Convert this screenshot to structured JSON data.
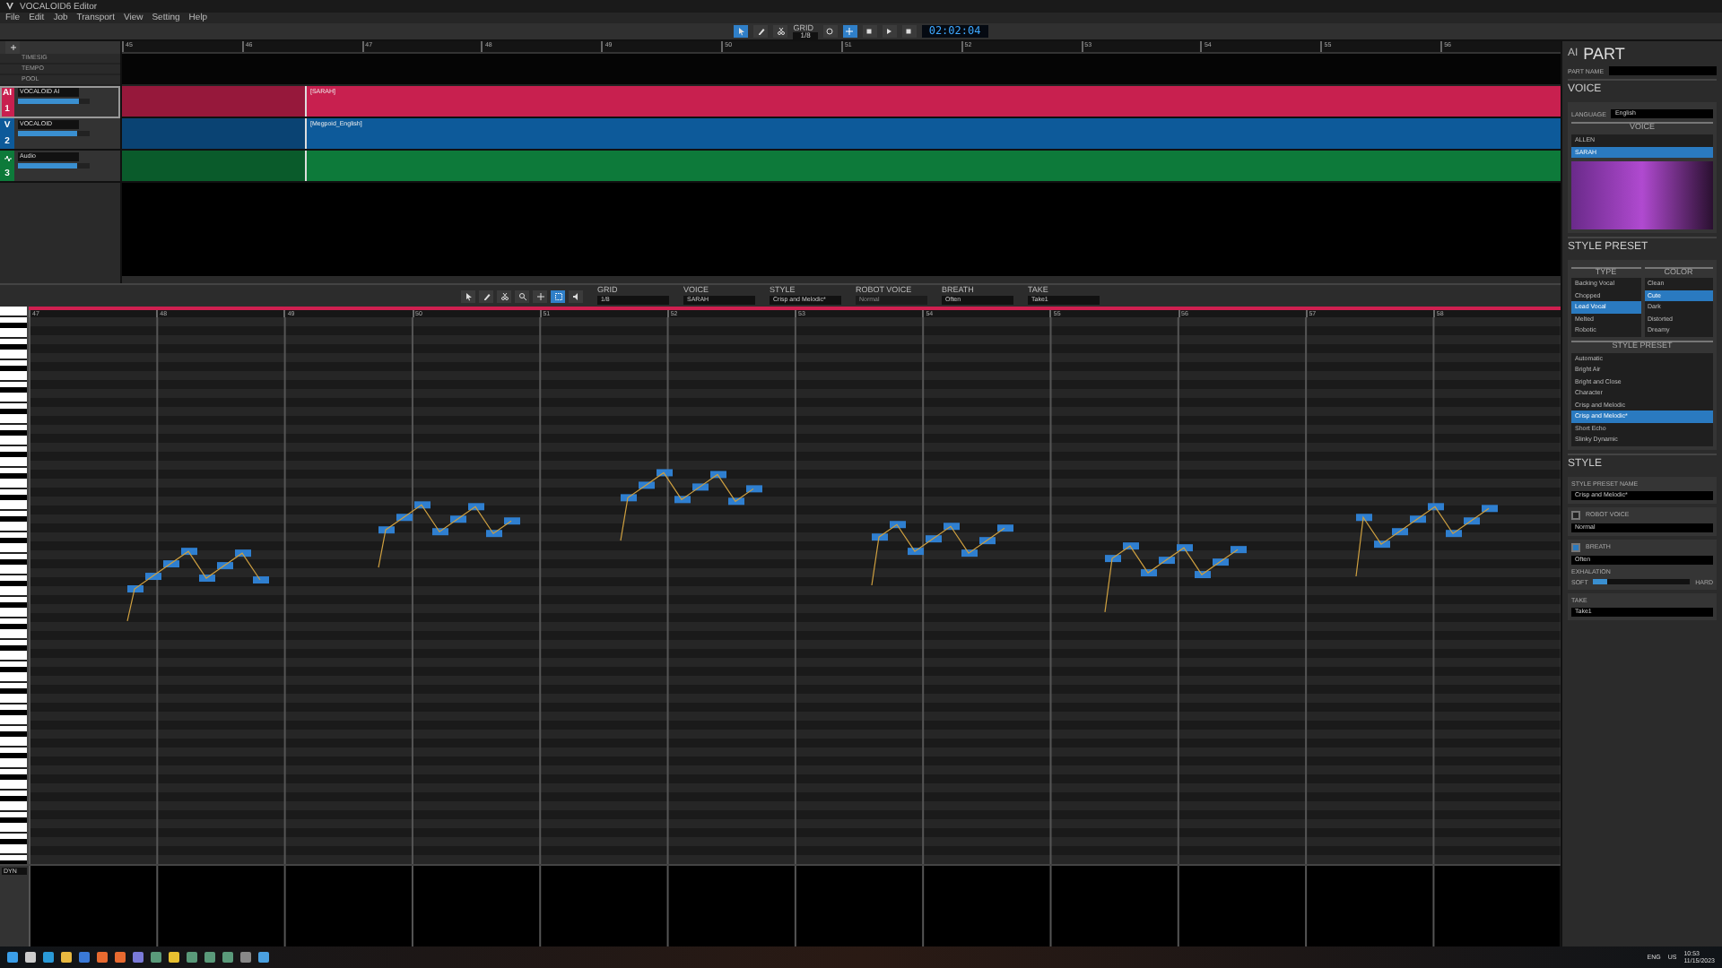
{
  "window": {
    "title": "VOCALOID6 Editor"
  },
  "menu": [
    "File",
    "Edit",
    "Job",
    "Transport",
    "View",
    "Setting",
    "Help"
  ],
  "toolbar": {
    "tools": [
      {
        "kind": "pointer",
        "selected": true
      },
      {
        "kind": "pencil",
        "selected": false
      },
      {
        "kind": "knife",
        "selected": false
      }
    ],
    "grid_label": "GRID",
    "grid_value": "1/8",
    "loop": false,
    "follow": true,
    "time": "02:02:04"
  },
  "global_tracks": [
    "TIMESIG",
    "TEMPO",
    "POOL"
  ],
  "tracks": [
    {
      "kind": "ai",
      "badge": "AI",
      "number": "1",
      "name": "VOCALOID AI",
      "color": "#c8204f",
      "part": "[SARAH]",
      "selected": true,
      "level": 0.85
    },
    {
      "kind": "vocaloid",
      "badge": "V",
      "number": "2",
      "name": "VOCALOID",
      "color": "#0d5a9a",
      "part": "[Megpoid_English]",
      "selected": false,
      "level": 0.82
    },
    {
      "kind": "audio",
      "number": "3",
      "name": "Audio",
      "color": "#0d7a3a",
      "selected": false,
      "level": 0.82
    }
  ],
  "ruler": [
    "45",
    "46",
    "47",
    "48",
    "49",
    "50",
    "51",
    "52",
    "53",
    "54",
    "55",
    "56"
  ],
  "piano_toolbar": {
    "tools": [
      {
        "kind": "pointer",
        "selected": false
      },
      {
        "kind": "pencil",
        "selected": false
      },
      {
        "kind": "knife",
        "selected": false
      },
      {
        "kind": "zoom",
        "selected": false
      },
      {
        "kind": "move",
        "selected": false
      },
      {
        "kind": "select",
        "selected": true
      },
      {
        "kind": "play",
        "selected": false
      }
    ],
    "fields": [
      {
        "label": "GRID",
        "value": "1/8"
      },
      {
        "label": "VOICE",
        "value": "SARAH"
      },
      {
        "label": "STYLE",
        "value": "Crisp and Melodic*"
      },
      {
        "label": "ROBOT VOICE",
        "value": "Normal",
        "disabled": true
      },
      {
        "label": "BREATH",
        "value": "Often",
        "disabled": false
      },
      {
        "label": "TAKE",
        "value": "Take1"
      }
    ]
  },
  "piano_ruler": [
    "47",
    "48",
    "49",
    "50",
    "51",
    "52",
    "53",
    "54",
    "55",
    "56",
    "57",
    "58"
  ],
  "control_track": {
    "parameter": "DYN"
  },
  "panel": {
    "badge": "AI",
    "title": "PART",
    "part_name_label": "PART NAME",
    "voice": {
      "title": "VOICE",
      "language_label": "LANGUAGE",
      "language": "English",
      "list_title": "VOICE",
      "items": [
        {
          "label": "ALLEN",
          "selected": false
        },
        {
          "label": "SARAH",
          "selected": true
        }
      ]
    },
    "style_preset": {
      "title": "STYLE PRESET",
      "type_title": "TYPE",
      "color_title": "COLOR",
      "types": [
        {
          "label": "Backing Vocal",
          "selected": false
        },
        {
          "label": "Chopped",
          "selected": false
        },
        {
          "label": "Lead Vocal",
          "selected": true
        },
        {
          "label": "Melted",
          "selected": false
        },
        {
          "label": "Robotic",
          "selected": false
        }
      ],
      "colors": [
        {
          "label": "Clean",
          "selected": false
        },
        {
          "label": "Cute",
          "selected": true
        },
        {
          "label": "Dark",
          "selected": false
        },
        {
          "label": "Distorted",
          "selected": false
        },
        {
          "label": "Dreamy",
          "selected": false
        }
      ],
      "presets_title": "STYLE PRESET",
      "presets": [
        {
          "label": "Automatic",
          "selected": false
        },
        {
          "label": "Bright Air",
          "selected": false
        },
        {
          "label": "Bright and Close",
          "selected": false
        },
        {
          "label": "Character",
          "selected": false
        },
        {
          "label": "Crisp and Melodic",
          "selected": false
        },
        {
          "label": "Crisp and Melodic*",
          "selected": true
        },
        {
          "label": "Short Echo",
          "selected": false
        },
        {
          "label": "Slinky Dynamic",
          "selected": false
        }
      ]
    },
    "style": {
      "title": "STYLE",
      "preset_name_label": "STYLE PRESET NAME",
      "preset_name": "Crisp and Melodic*",
      "robot_voice": {
        "label": "ROBOT VOICE",
        "checked": false,
        "value": "Normal"
      },
      "breath": {
        "label": "BREATH",
        "checked": true,
        "value": "Often",
        "exhalation_label": "EXHALATION",
        "soft": "SOFT",
        "hard": "HARD",
        "level": 0.15
      },
      "take_label": "TAKE",
      "take": "Take1"
    }
  },
  "taskbar": {
    "apps": [
      {
        "kind": "start"
      },
      {
        "kind": "search"
      },
      {
        "kind": "edge"
      },
      {
        "kind": "folder"
      },
      {
        "kind": "store"
      },
      {
        "kind": "browser"
      },
      {
        "kind": "browser"
      },
      {
        "kind": "disk"
      },
      {
        "kind": "app"
      },
      {
        "kind": "chrome"
      },
      {
        "kind": "app"
      },
      {
        "kind": "app"
      },
      {
        "kind": "app"
      },
      {
        "kind": "vocaloid"
      },
      {
        "kind": "globe"
      }
    ],
    "tray": [
      "ENG",
      "US"
    ],
    "time": "10:53",
    "date": "11/15/2023"
  }
}
